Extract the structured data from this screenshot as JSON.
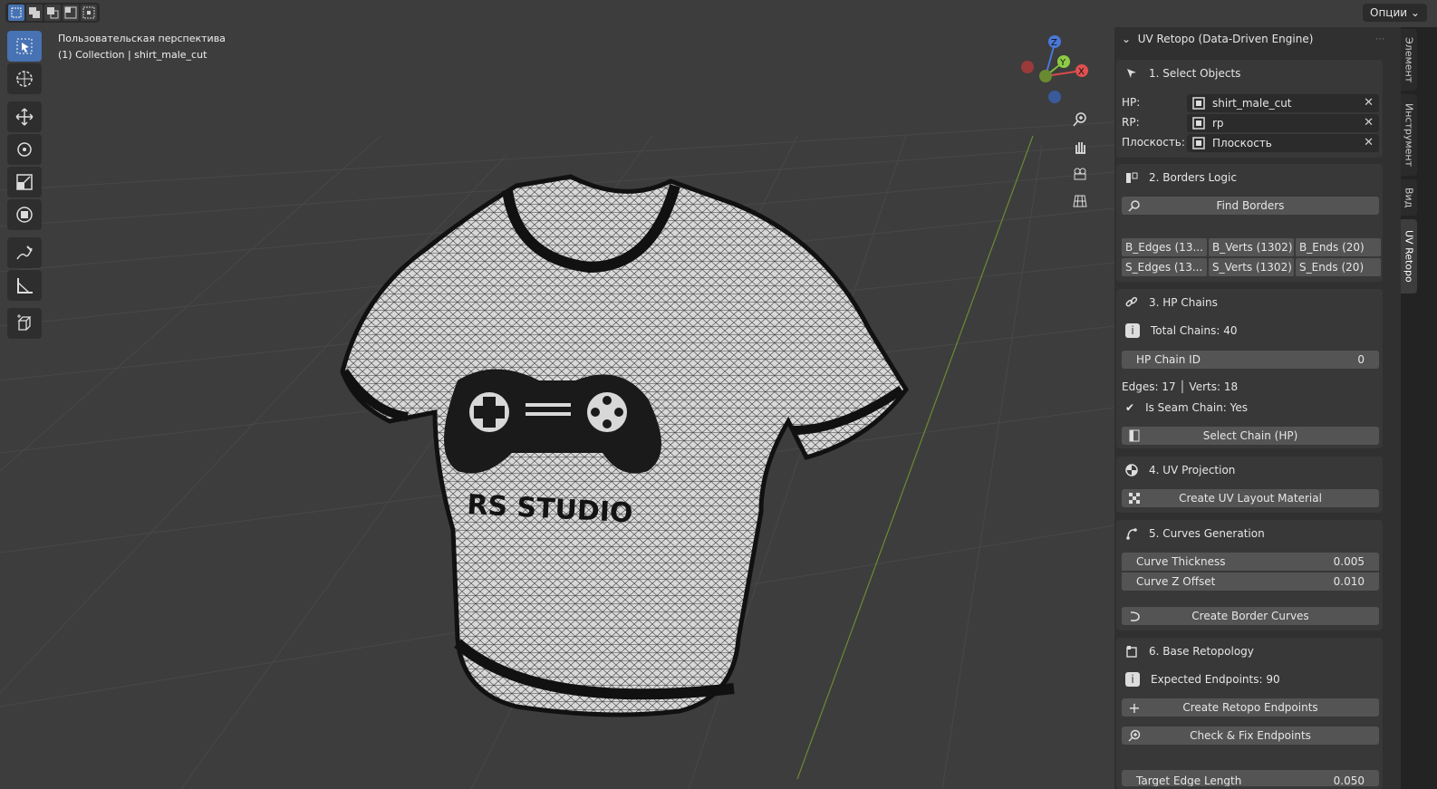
{
  "viewport": {
    "view_name": "Пользовательская перспектива",
    "collection_info": "(1) Collection | shirt_male_cut",
    "options_label": "Опции",
    "model": {
      "print_text": "RS STUDIO"
    },
    "gizmo": {
      "z": "Z",
      "y": "Y",
      "x": "X"
    }
  },
  "toolbar": {
    "tools": [
      "select-box",
      "cursor",
      "move",
      "rotate",
      "scale",
      "transform",
      "annotate",
      "measure",
      "add-cube"
    ]
  },
  "panel": {
    "title": "UV Retopo (Data-Driven Engine)",
    "s1": {
      "title": "1. Select Objects",
      "hp_label": "HP:",
      "hp_value": "shirt_male_cut",
      "rp_label": "RP:",
      "rp_value": "rp",
      "plane_label": "Плоскость:",
      "plane_value": "Плоскость",
      "clear": "✕"
    },
    "s2": {
      "title": "2. Borders Logic",
      "find_borders": "Find Borders",
      "grid": [
        "B_Edges (13...",
        "B_Verts (1302)",
        "B_Ends (20)",
        "S_Edges (13...",
        "S_Verts (1302)",
        "S_Ends (20)"
      ]
    },
    "s3": {
      "title": "3. HP Chains",
      "total_chains": "Total Chains: 40",
      "chain_id_label": "HP Chain ID",
      "chain_id_value": "0",
      "edges_verts": "Edges: 17  │  Verts: 18",
      "is_seam": "Is Seam Chain: Yes",
      "select_chain": "Select Chain (HP)"
    },
    "s4": {
      "title": "4. UV Projection",
      "create_material": "Create UV Layout Material"
    },
    "s5": {
      "title": "5. Curves Generation",
      "thickness_label": "Curve Thickness",
      "thickness_value": "0.005",
      "zoffset_label": "Curve Z Offset",
      "zoffset_value": "0.010",
      "create_curves": "Create Border Curves"
    },
    "s6": {
      "title": "6. Base Retopology",
      "expected": "Expected Endpoints: 90",
      "create_endpoints": "Create Retopo Endpoints",
      "check_fix": "Check & Fix Endpoints",
      "target_edge_label": "Target Edge Length",
      "target_edge_value": "0.050"
    }
  },
  "tabs": [
    "Элемент",
    "Инструмент",
    "Вид",
    "UV Retopo"
  ],
  "colors": {
    "accent": "#4772b3",
    "panel_bg": "#303030",
    "section_bg": "#383838",
    "button": "#545454",
    "viewport": "#3d3d3d"
  }
}
